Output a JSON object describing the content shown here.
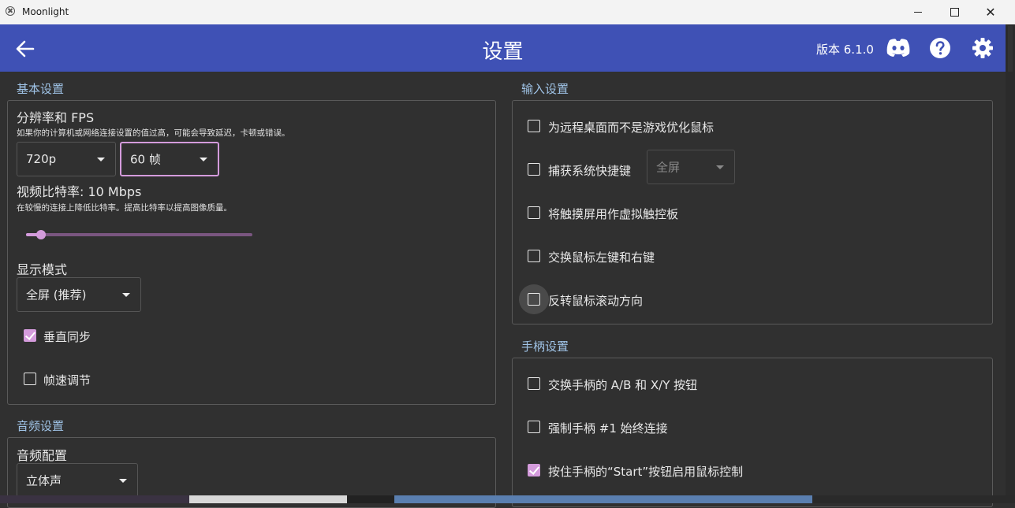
{
  "window": {
    "title": "Moonlight"
  },
  "header": {
    "title": "设置",
    "version": "版本 6.1.0",
    "colors": {
      "bar": "#3f51b5",
      "accent": "#d49bdc",
      "section": "#9fc3e6"
    },
    "icons": [
      "back-arrow-icon",
      "discord-icon",
      "help-icon",
      "gear-icon"
    ]
  },
  "basic": {
    "section_label": "基本设置",
    "resolution_title": "分辨率和 FPS",
    "resolution_hint": "如果你的计算机或网络连接设置的值过高，可能会导致延迟，卡顿或错误。",
    "resolution_value": "720p",
    "fps_value": "60 帧",
    "bitrate_title": "视频比特率: 10 Mbps",
    "bitrate_hint": "在较慢的连接上降低比特率。提高比特率以提高图像质量。",
    "bitrate_level_mbps": 10,
    "display_mode_title": "显示模式",
    "display_mode_value": "全屏 (推荐)",
    "vsync_label": "垂直同步",
    "vsync_checked": true,
    "frame_pacing_label": "帧速调节",
    "frame_pacing_checked": false
  },
  "audio": {
    "section_label": "音频设置",
    "config_title": "音频配置",
    "config_value": "立体声"
  },
  "input": {
    "section_label": "输入设置",
    "items": [
      {
        "label": "为远程桌面而不是游戏优化鼠标",
        "checked": false
      },
      {
        "label": "捕获系统快捷键",
        "checked": false
      },
      {
        "label": "将触摸屏用作虚拟触控板",
        "checked": false
      },
      {
        "label": "交换鼠标左键和右键",
        "checked": false
      },
      {
        "label": "反转鼠标滚动方向",
        "checked": false
      }
    ],
    "shortcut_mode_value": "全屏"
  },
  "gamepad": {
    "section_label": "手柄设置",
    "items": [
      {
        "label": "交换手柄的 A/B 和 X/Y 按钮",
        "checked": false
      },
      {
        "label": "强制手柄 #1 始终连接",
        "checked": false
      },
      {
        "label": "按住手柄的“Start”按钮启用鼠标控制",
        "checked": true
      }
    ]
  }
}
